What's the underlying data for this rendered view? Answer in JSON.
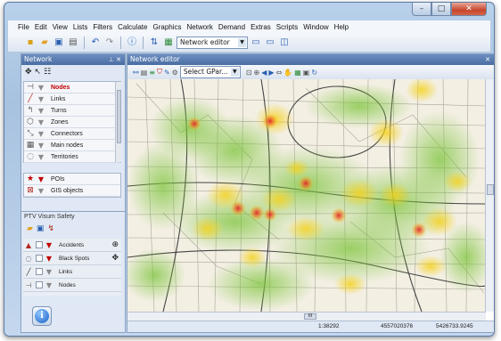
{
  "menu": [
    "File",
    "Edit",
    "View",
    "Lists",
    "Filters",
    "Calculate",
    "Graphics",
    "Network",
    "Demand",
    "Extras",
    "Scripts",
    "Window",
    "Help"
  ],
  "toolbar": {
    "editor_select": "Network editor"
  },
  "network_panel": {
    "title": "Network",
    "items": [
      {
        "label": "Nodes",
        "icon": "node-icon",
        "selected": true
      },
      {
        "label": "Links",
        "icon": "link-icon"
      },
      {
        "label": "Turns",
        "icon": "turn-icon"
      },
      {
        "label": "Zones",
        "icon": "zone-icon"
      },
      {
        "label": "Connectors",
        "icon": "connector-icon"
      },
      {
        "label": "Main nodes",
        "icon": "main-node-icon"
      },
      {
        "label": "Territories",
        "icon": "territory-icon"
      }
    ],
    "extra_items": [
      {
        "label": "POIs",
        "icon": "poi-icon"
      },
      {
        "label": "GIS objects",
        "icon": "gis-icon"
      }
    ]
  },
  "safety_panel": {
    "title": "PTV Visum Safety",
    "items": [
      {
        "label": "Accidents",
        "icon": "accident-icon"
      },
      {
        "label": "Black Spots",
        "icon": "blackspot-icon"
      },
      {
        "label": "Links",
        "icon": "link-icon"
      },
      {
        "label": "Nodes",
        "icon": "node-icon"
      }
    ]
  },
  "editor": {
    "title": "Network editor",
    "select_label": "Select GPar...",
    "status": {
      "scale": "1:38292",
      "x": "4557020376",
      "y": "5426733.9245"
    }
  },
  "colors": {
    "accent": "#4a6da3",
    "hotspot_red": "#e0242a",
    "hotspot_yellow": "#f4d21e",
    "hotspot_green": "#7cc43a"
  }
}
